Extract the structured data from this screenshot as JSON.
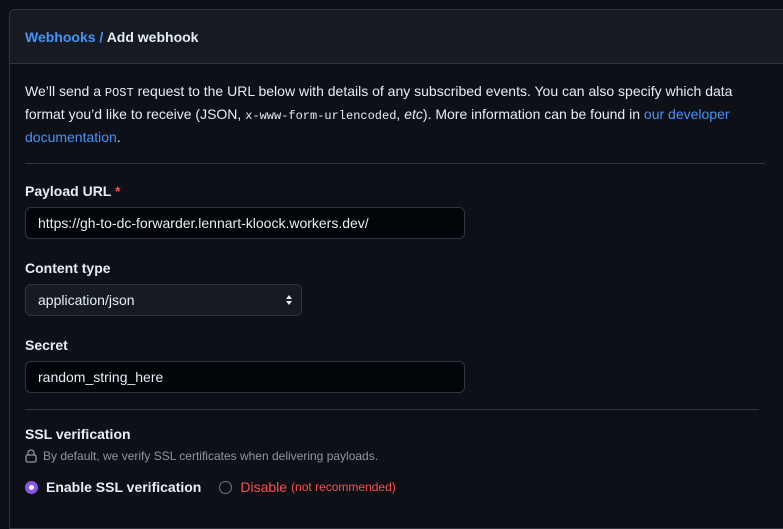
{
  "breadcrumb": {
    "parent": "Webhooks",
    "separator": "/",
    "current": "Add webhook"
  },
  "intro": {
    "part1": "We’ll send a ",
    "post": "POST",
    "part2": " request to the URL below with details of any subscribed events. You can also specify which data format you’d like to receive (JSON, ",
    "form": "x-www-form-urlencoded",
    "part3": ", ",
    "etc": "etc",
    "part4": "). More information can be found in ",
    "link": "our developer documentation",
    "part5": "."
  },
  "payload_url": {
    "label": "Payload URL",
    "required_mark": "*",
    "value": "https://gh-to-dc-forwarder.lennart-kloock.workers.dev/"
  },
  "content_type": {
    "label": "Content type",
    "value": "application/json"
  },
  "secret": {
    "label": "Secret",
    "value": "random_string_here"
  },
  "ssl": {
    "title": "SSL verification",
    "note": "By default, we verify SSL certificates when delivering payloads.",
    "enable_label": "Enable SSL verification",
    "disable_label": "Disable",
    "disable_note": "(not recommended)",
    "selected": "enable"
  },
  "colors": {
    "accent_link": "#4493f8",
    "danger": "#f85149",
    "radio_selected": "#8957e5"
  }
}
